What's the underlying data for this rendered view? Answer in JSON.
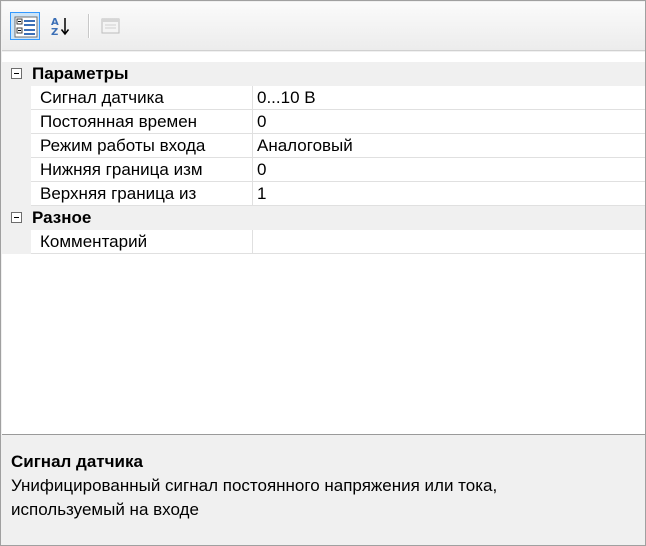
{
  "toolbar": {
    "buttons": [
      {
        "icon": "categorized-view-icon",
        "active": true
      },
      {
        "icon": "sort-alphabetical-icon",
        "active": false
      },
      {
        "icon": "property-pages-icon",
        "active": false,
        "enabled": false
      }
    ]
  },
  "categories": [
    {
      "label": "Параметры",
      "expanded": true,
      "properties": [
        {
          "name": "Сигнал датчика",
          "value": "0...10 В"
        },
        {
          "name": "Постоянная времен",
          "value": "0"
        },
        {
          "name": "Режим работы входа",
          "value": "Аналоговый"
        },
        {
          "name": "Нижняя граница изм",
          "value": "0"
        },
        {
          "name": "Верхняя граница из",
          "value": "1"
        }
      ]
    },
    {
      "label": "Разное",
      "expanded": true,
      "properties": [
        {
          "name": "Комментарий",
          "value": ""
        }
      ]
    }
  ],
  "description": {
    "title": "Сигнал датчика",
    "text": "Унифицированный сигнал постоянного напряжения или тока, используемый на входе"
  },
  "colors": {
    "selection_border": "#3399ff",
    "selection_fill": "#cce4f7",
    "panel_bg": "#f0f0f0",
    "grid_line": "#e0e0e0"
  }
}
